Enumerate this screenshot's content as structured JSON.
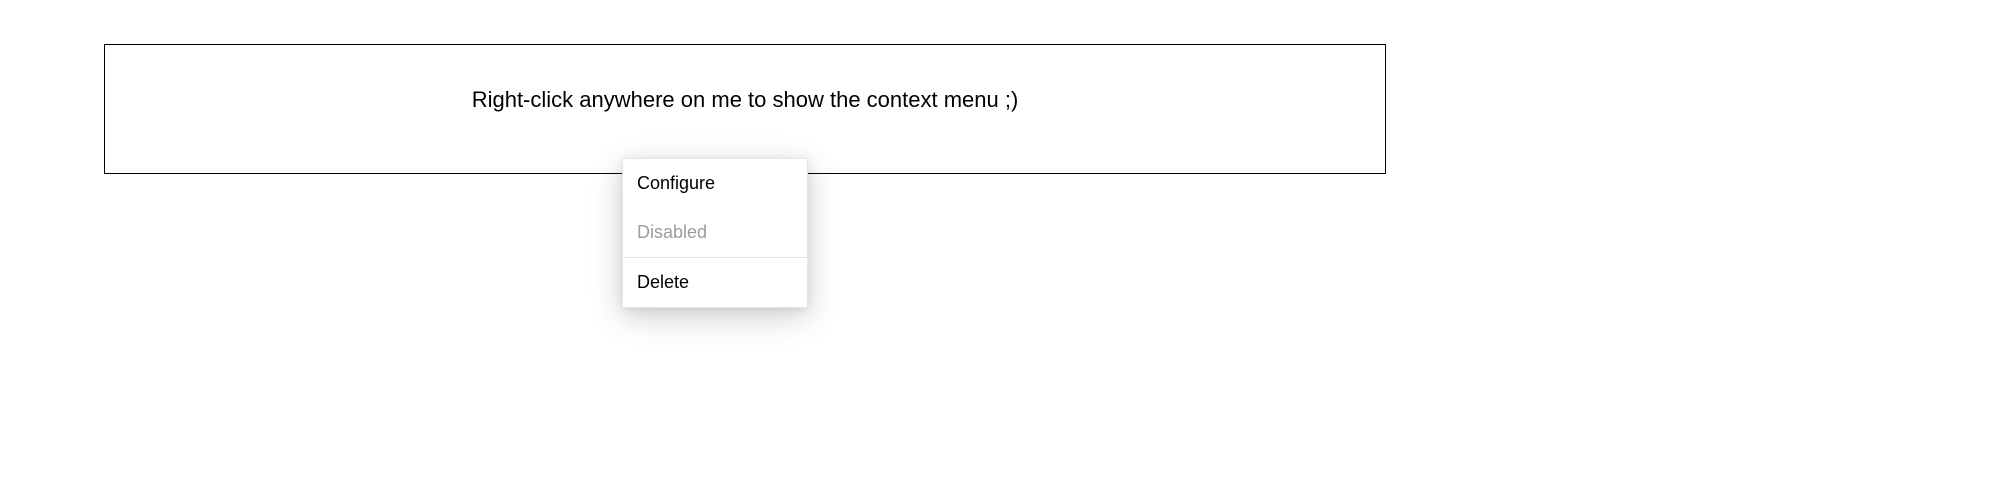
{
  "target": {
    "instruction": "Right-click anywhere on me to show the context menu ;)"
  },
  "contextMenu": {
    "items": [
      {
        "label": "Configure",
        "enabled": true
      },
      {
        "label": "Disabled",
        "enabled": false
      },
      {
        "label": "Delete",
        "enabled": true
      }
    ]
  }
}
